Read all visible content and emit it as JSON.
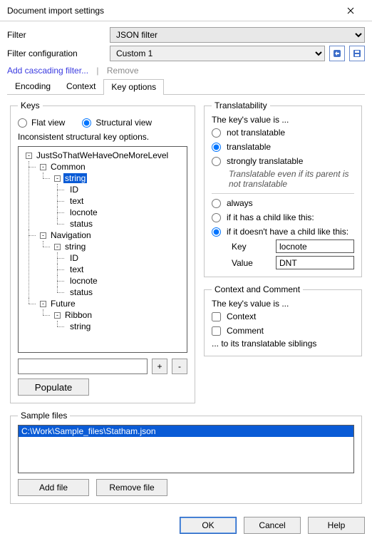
{
  "window": {
    "title": "Document import settings"
  },
  "filter": {
    "label": "Filter",
    "value": "JSON filter",
    "cfg_label": "Filter configuration",
    "cfg_value": "Custom 1"
  },
  "links": {
    "add": "Add cascading filter...",
    "remove": "Remove"
  },
  "tabs": {
    "encoding": "Encoding",
    "context": "Context",
    "key_options": "Key options"
  },
  "keys": {
    "legend": "Keys",
    "flat": "Flat view",
    "structural": "Structural view",
    "note": "Inconsistent structural key options.",
    "populate": "Populate",
    "plus": "+",
    "minus": "-",
    "tree": {
      "n0": "JustSoThatWeHaveOneMoreLevel",
      "n1": "Common",
      "n2": "string",
      "n3": "ID",
      "n4": "text",
      "n5": "locnote",
      "n6": "status",
      "n7": "Navigation",
      "n8": "string",
      "n9": "ID",
      "n10": "text",
      "n11": "locnote",
      "n12": "status",
      "n13": "Future",
      "n14": "Ribbon",
      "n15": "string"
    }
  },
  "trans": {
    "legend": "Translatability",
    "intro": "The key's value is ...",
    "not": "not translatable",
    "translatable": "translatable",
    "strongly": "strongly translatable",
    "strong_note": "Translatable even if its parent is not translatable",
    "always": "always",
    "haschild": "if it has a child like this:",
    "nochild": "if it doesn't have a child like this:",
    "key_label": "Key",
    "key_value": "locnote",
    "val_label": "Value",
    "val_value": "DNT"
  },
  "ctx": {
    "legend": "Context and Comment",
    "intro": "The key's value is ...",
    "context": "Context",
    "comment": "Comment",
    "note": "... to its translatable siblings"
  },
  "sample": {
    "legend": "Sample files",
    "path": "C:\\Work\\Sample_files\\Statham.json",
    "add": "Add file",
    "remove": "Remove file"
  },
  "buttons": {
    "ok": "OK",
    "cancel": "Cancel",
    "help": "Help"
  }
}
